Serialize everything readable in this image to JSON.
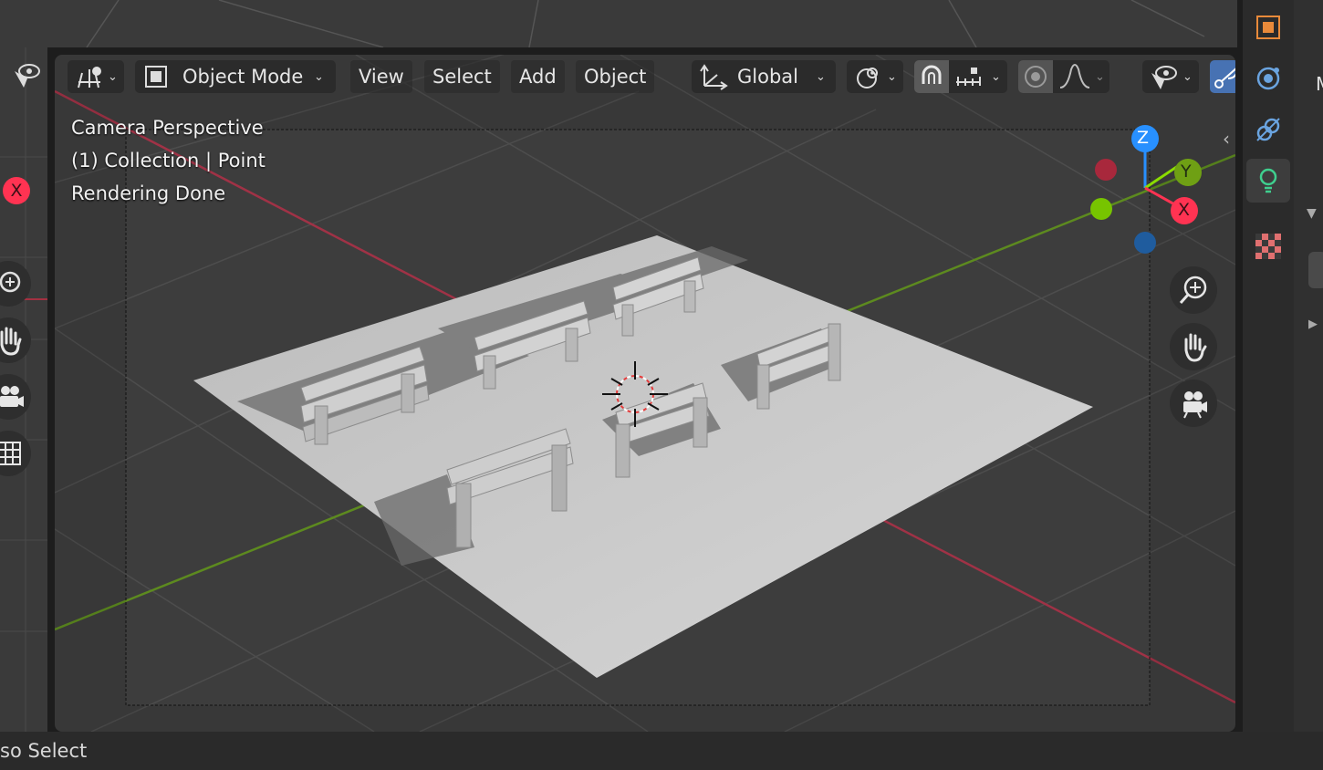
{
  "header": {
    "object_mode_label": "Object Mode",
    "menus": [
      "View",
      "Select",
      "Add",
      "Object"
    ],
    "transform_orientation": "Global"
  },
  "viewport_overlay": {
    "line1": "Camera Perspective",
    "line2": "(1) Collection | Point",
    "line3": "Rendering Done"
  },
  "gizmo": {
    "z_label": "Z",
    "y_label": "Y",
    "x_label": "X",
    "colors": {
      "x": "#ff3352",
      "y": "#8bdc00",
      "z": "#2890ff"
    }
  },
  "left_viewport": {
    "x_axis_label": "X"
  },
  "props_panel": {
    "partial_label": "M"
  },
  "status_bar": {
    "text": "so Select"
  },
  "icons": {
    "header": [
      "view-icon",
      "object-mode-icon",
      "transform-orientation-icon",
      "pivot-icon",
      "snap-icon",
      "snap-increment-icon",
      "proportional-edit-icon",
      "falloff-icon",
      "overlay-visibility-icon",
      "gizmo-toggle-icon"
    ],
    "nav": [
      "zoom-icon",
      "pan-hand-icon",
      "camera-icon"
    ],
    "props_tabs": [
      "object-tab-icon",
      "physics-tab-icon",
      "constraints-tab-icon",
      "light-data-tab-icon",
      "texture-tab-icon"
    ]
  }
}
